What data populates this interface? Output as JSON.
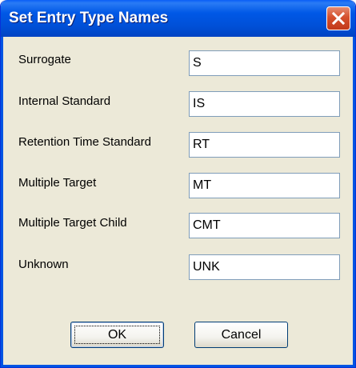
{
  "window": {
    "title": "Set Entry Type Names"
  },
  "fields": [
    {
      "label": "Surrogate",
      "value": "S"
    },
    {
      "label": "Internal Standard",
      "value": "IS"
    },
    {
      "label": "Retention Time Standard",
      "value": "RT"
    },
    {
      "label": "Multiple Target",
      "value": "MT"
    },
    {
      "label": "Multiple Target Child",
      "value": "CMT"
    },
    {
      "label": "Unknown",
      "value": "UNK"
    }
  ],
  "buttons": {
    "ok_label": "OK",
    "cancel_label": "Cancel"
  },
  "icons": {
    "close": "close-icon"
  },
  "colors": {
    "titlebar": "#0058e6",
    "dialog_bg": "#ece9d8",
    "close_button": "#d5502d"
  }
}
